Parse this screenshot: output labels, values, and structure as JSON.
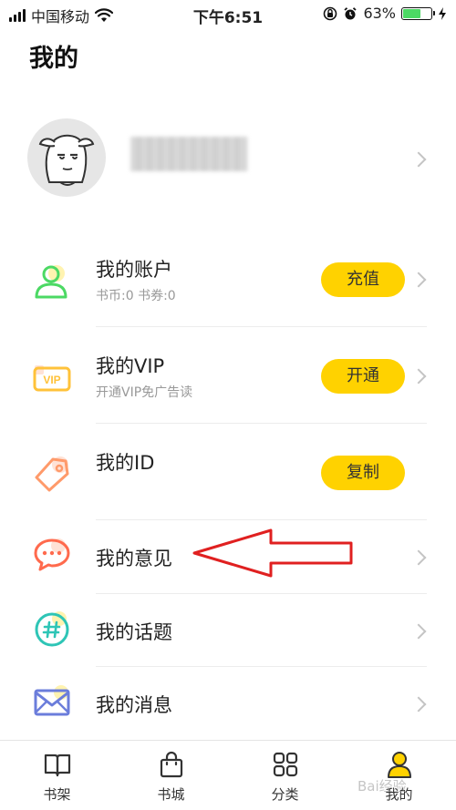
{
  "status_bar": {
    "carrier": "中国移动",
    "time": "下午6:51",
    "battery_percent": "63%",
    "battery_level": 0.63,
    "icons": [
      "signal-icon",
      "wifi-icon",
      "orientation-lock-icon",
      "alarm-icon",
      "battery-icon",
      "charging-icon"
    ]
  },
  "page": {
    "title": "我的"
  },
  "menu": {
    "account": {
      "title": "我的账户",
      "subtitle": "书币:0 书券:0",
      "button": "充值",
      "icon": "user-icon",
      "color": "#4cd964"
    },
    "vip": {
      "title": "我的VIP",
      "subtitle": "开通VIP免广告读",
      "button": "开通",
      "icon": "vip-icon",
      "color": "#ffc23a"
    },
    "id": {
      "title": "我的ID",
      "button": "复制",
      "icon": "tag-icon",
      "color": "#ff9a6a"
    },
    "feedback": {
      "title": "我的意见",
      "icon": "chat-bubble-icon",
      "color": "#ff6a4d"
    },
    "topics": {
      "title": "我的话题",
      "icon": "hashtag-icon",
      "color": "#2ec5b6"
    },
    "messages": {
      "title": "我的消息",
      "icon": "envelope-icon",
      "color": "#6b7ddb"
    }
  },
  "tabbar": {
    "tabs": [
      {
        "label": "书架",
        "icon": "book-icon"
      },
      {
        "label": "书城",
        "icon": "shopping-bag-icon"
      },
      {
        "label": "分类",
        "icon": "grid-icon"
      },
      {
        "label": "我的",
        "icon": "profile-icon",
        "active": true
      }
    ]
  },
  "accent_color": "#ffd200",
  "annotation": {
    "type": "red-arrow",
    "points_to": "menu.feedback",
    "color": "#e02020"
  },
  "watermark": "Bai经验"
}
